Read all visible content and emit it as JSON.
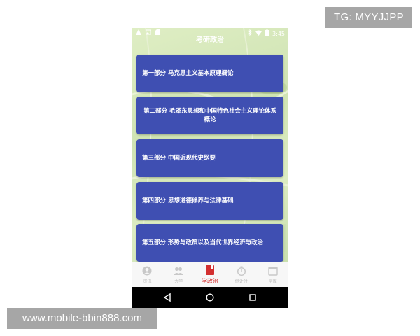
{
  "watermarks": {
    "top": "TG: MYYJJPP",
    "bottom": "www.mobile-bbin888.com"
  },
  "status_bar": {
    "time": "3:45",
    "icons_left": [
      "warning-icon",
      "image-icon",
      "sd-card-icon"
    ],
    "icons_right": [
      "bluetooth-icon",
      "wifi-icon",
      "battery-icon"
    ]
  },
  "app": {
    "title": "考研政治"
  },
  "parts": [
    {
      "label": "第一部分 马克思主义基本原理概论"
    },
    {
      "label": "第二部分 毛泽东思想和中国特色社会主义理论体系概论"
    },
    {
      "label": "第三部分 中国近现代史纲要"
    },
    {
      "label": "第四部分 思想道德修养与法律基础"
    },
    {
      "label": "第五部分 形势与政策以及当代世界经济与政治"
    }
  ],
  "tabs": [
    {
      "label": "资讯",
      "icon": "person-icon",
      "active": false
    },
    {
      "label": "大学",
      "icon": "people-icon",
      "active": false
    },
    {
      "label": "学政治",
      "icon": "book-icon",
      "active": true
    },
    {
      "label": "倒计时",
      "icon": "stopwatch-icon",
      "active": false
    },
    {
      "label": "字库",
      "icon": "calendar-icon",
      "active": false
    }
  ],
  "colors": {
    "card": "#3f4fb2",
    "active_tab": "#d32f2f",
    "inactive_tab": "#bdbdbd",
    "background": "#d8e8c0"
  }
}
